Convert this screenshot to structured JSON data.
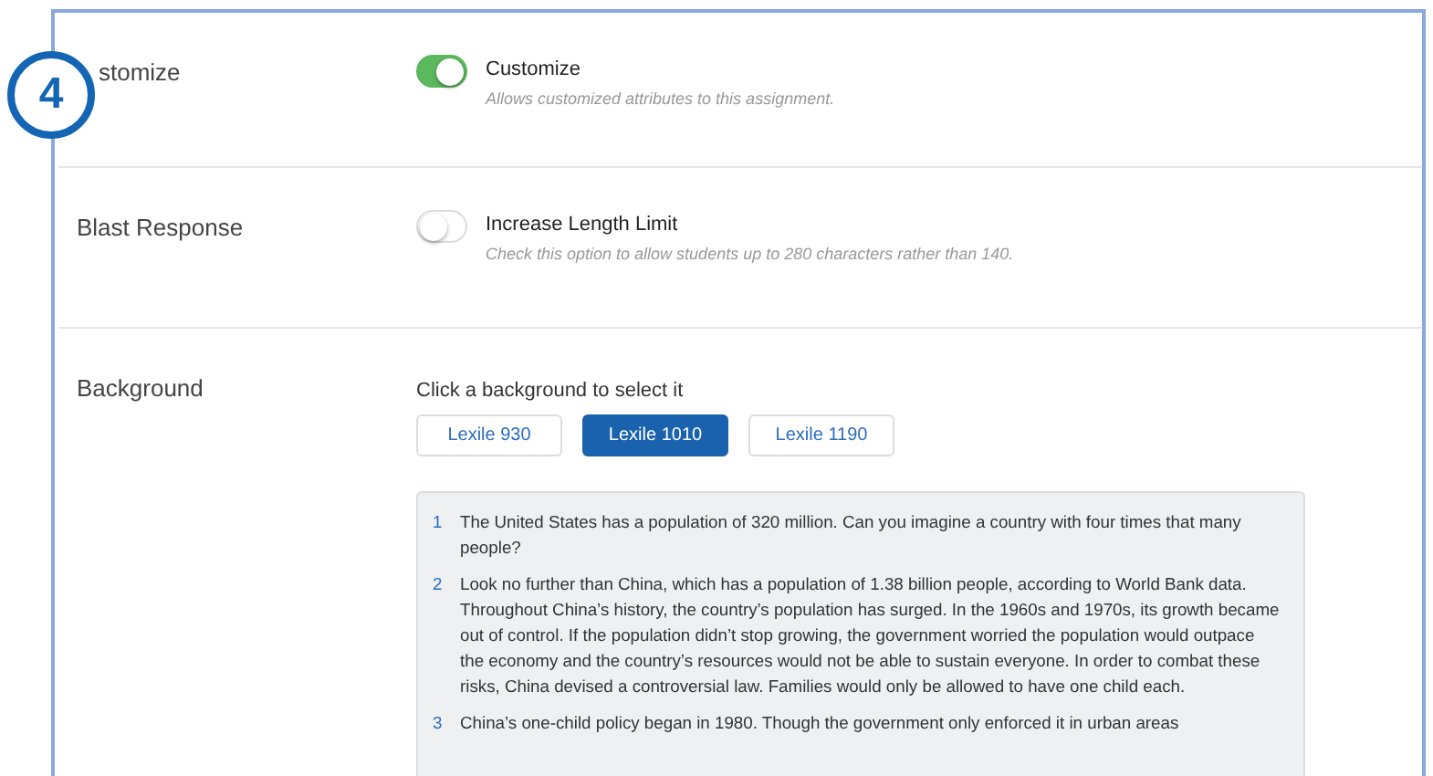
{
  "badge": {
    "text": "4"
  },
  "sections": [
    {
      "label": "stomize",
      "kind": "toggle",
      "toggle": {
        "on": true,
        "title": "Customize",
        "description": "Allows customized attributes to this assignment."
      }
    },
    {
      "label": "Blast Response",
      "kind": "toggle",
      "toggle": {
        "on": false,
        "title": "Increase Length Limit",
        "description": "Check this option to allow students up to 280 characters rather than 140."
      }
    },
    {
      "label": "Background",
      "kind": "background",
      "prompt": "Click a background to select it",
      "options": [
        {
          "label": "Lexile 930",
          "selected": false
        },
        {
          "label": "Lexile 1010",
          "selected": true
        },
        {
          "label": "Lexile 1190",
          "selected": false
        }
      ],
      "passage": [
        {
          "number": "1",
          "text": "The United States has a population of 320 million. Can you imagine a country with four times that many people?"
        },
        {
          "number": "2",
          "text": "Look no further than China, which has a population of 1.38 billion people, according to World Bank data. Throughout China’s history, the country’s population has surged. In the 1960s and 1970s, its growth became out of control. If the population didn’t stop growing, the government worried the population would outpace the economy and the country’s resources would not be able to sustain everyone. In order to combat these risks, China devised a controversial law. Families would only be allowed to have one child each."
        },
        {
          "number": "3",
          "text": "China’s one-child policy began in 1980. Though the government only enforced it in urban areas"
        }
      ]
    }
  ]
}
